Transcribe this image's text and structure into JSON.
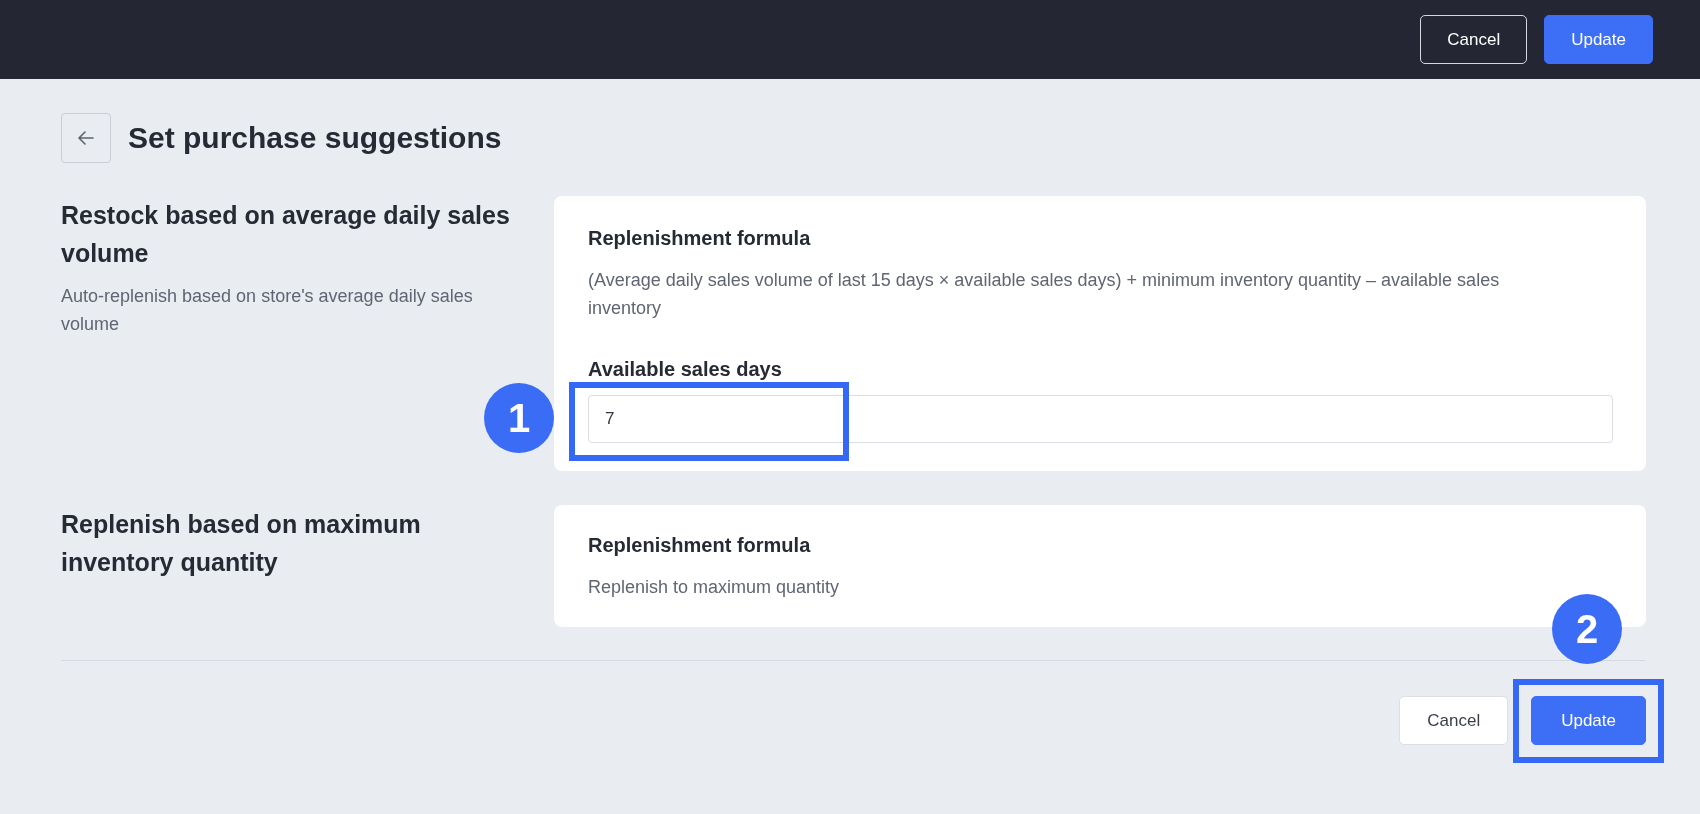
{
  "top_bar": {
    "buttons": [
      {
        "label": "Cancel",
        "kind": "secondary"
      },
      {
        "label": "Update",
        "kind": "primary"
      }
    ]
  },
  "header": {
    "title": "Set purchase suggestions"
  },
  "sections": [
    {
      "title": "Restock based on average daily sales volume",
      "description": "Auto-replenish based on store's average daily sales volume",
      "card": {
        "heading": "Replenishment formula",
        "text": "(Average daily sales volume of last 15 days × available sales days) + minimum inventory quantity – available sales inventory",
        "field": {
          "label": "Available sales days",
          "value": "7",
          "callout": "1"
        }
      }
    },
    {
      "title": "Replenish based on maximum inventory quantity",
      "card": {
        "heading": "Replenishment formula",
        "text": "Replenish to maximum quantity"
      }
    }
  ],
  "footer": {
    "buttons": [
      {
        "label": "Cancel",
        "kind": "secondary"
      },
      {
        "label": "Update",
        "kind": "primary",
        "callout": "2"
      }
    ]
  }
}
